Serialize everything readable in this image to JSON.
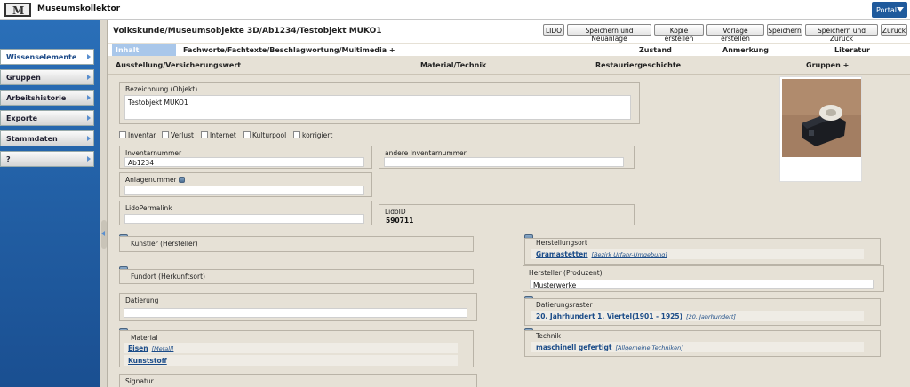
{
  "app": {
    "title": "Museumskollektor",
    "portal_label": "Portal"
  },
  "sidebar": {
    "items": [
      {
        "label": "Wissenselemente",
        "active": true
      },
      {
        "label": "Gruppen"
      },
      {
        "label": "Arbeitshistorie"
      },
      {
        "label": "Exporte"
      },
      {
        "label": "Stammdaten"
      },
      {
        "label": "?"
      }
    ]
  },
  "header": {
    "title": "Volkskunde/Museumsobjekte 3D/Ab1234/Testobjekt MUKO1",
    "buttons": [
      "LIDO",
      "Speichern und Neuanlage",
      "Kopie erstellen",
      "Vorlage erstellen",
      "Speichern",
      "Speichern und Zurück",
      "Zurück"
    ]
  },
  "tabs": {
    "row1": [
      "Inhalt",
      "Fachworte/Fachtexte/Beschlagwortung/Multimedia +",
      "Zustand",
      "Anmerkung",
      "Literatur"
    ],
    "row2": [
      "Ausstellung/Versicherungswert",
      "Material/Technik",
      "Restauriergeschichte",
      "Gruppen +"
    ]
  },
  "form": {
    "bezeichnung": {
      "label": "Bezeichnung (Objekt)",
      "value": "Testobjekt MUKO1"
    },
    "checkboxes": [
      "Inventar",
      "Verlust",
      "Internet",
      "Kulturpool",
      "korrigiert"
    ],
    "inventarnummer": {
      "label": "Inventarnummer",
      "value": "Ab1234"
    },
    "andere_inventarnummer": {
      "label": "andere Inventarnummer",
      "value": ""
    },
    "anlagenummer": {
      "label": "Anlagenummer",
      "value": ""
    },
    "lido_permalink": {
      "label": "LidoPermalink",
      "value": ""
    },
    "lido_id": {
      "label": "LidoID",
      "value": "590711"
    },
    "kuenstler": {
      "label": "Künstler (Hersteller)"
    },
    "fundort": {
      "label": "Fundort (Herkunftsort)"
    },
    "datierung": {
      "label": "Datierung",
      "value": ""
    },
    "material": {
      "label": "Material",
      "entries": [
        {
          "value": "Eisen",
          "type": "[Metall]"
        },
        {
          "value": "Kunststoff",
          "type": ""
        }
      ]
    },
    "signatur": {
      "label": "Signatur"
    },
    "herstellungsort": {
      "label": "Herstellungsort",
      "value": "Gramastetten",
      "type": "[Bezirk Urfahr-Umgebung]"
    },
    "hersteller": {
      "label": "Hersteller (Produzent)",
      "value": "Musterwerke"
    },
    "datierungsraster": {
      "label": "Datierungsraster",
      "value": "20. Jahrhundert 1. Viertel(1901 - 1925)",
      "type": "[20. Jahrhundert]"
    },
    "technik": {
      "label": "Technik",
      "value": "maschinell gefertigt",
      "type": "[Allgemeine Techniken]"
    }
  }
}
